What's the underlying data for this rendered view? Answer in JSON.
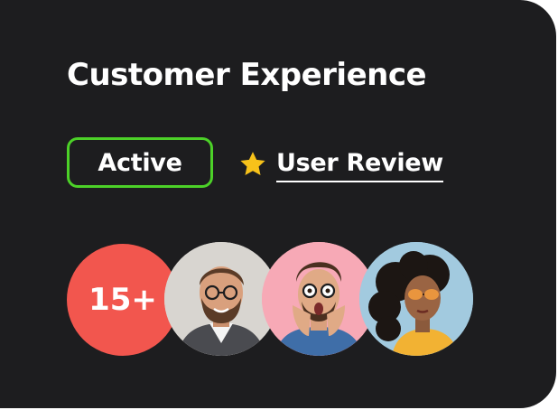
{
  "card": {
    "title": "Customer Experience",
    "status_badge": "Active",
    "review_link": "User Review",
    "review_icon": "star-icon",
    "member_count": "15+"
  },
  "colors": {
    "card_background": "#1d1d1f",
    "badge_border": "#4cd128",
    "star": "#f7c21a",
    "count_bubble": "#f2564e"
  }
}
